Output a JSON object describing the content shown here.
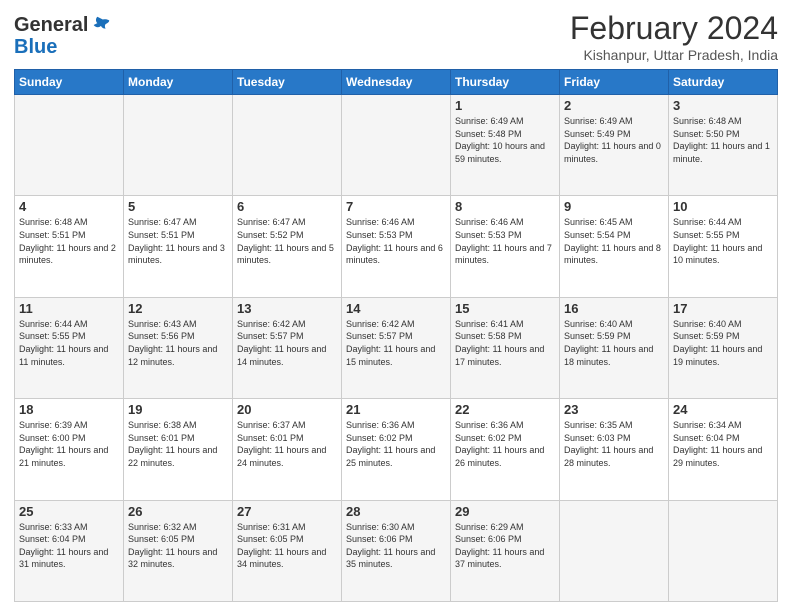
{
  "header": {
    "logo_general": "General",
    "logo_blue": "Blue",
    "month_title": "February 2024",
    "location": "Kishanpur, Uttar Pradesh, India"
  },
  "days_of_week": [
    "Sunday",
    "Monday",
    "Tuesday",
    "Wednesday",
    "Thursday",
    "Friday",
    "Saturday"
  ],
  "weeks": [
    [
      {
        "day": "",
        "info": ""
      },
      {
        "day": "",
        "info": ""
      },
      {
        "day": "",
        "info": ""
      },
      {
        "day": "",
        "info": ""
      },
      {
        "day": "1",
        "info": "Sunrise: 6:49 AM\nSunset: 5:48 PM\nDaylight: 10 hours and 59 minutes."
      },
      {
        "day": "2",
        "info": "Sunrise: 6:49 AM\nSunset: 5:49 PM\nDaylight: 11 hours and 0 minutes."
      },
      {
        "day": "3",
        "info": "Sunrise: 6:48 AM\nSunset: 5:50 PM\nDaylight: 11 hours and 1 minute."
      }
    ],
    [
      {
        "day": "4",
        "info": "Sunrise: 6:48 AM\nSunset: 5:51 PM\nDaylight: 11 hours and 2 minutes."
      },
      {
        "day": "5",
        "info": "Sunrise: 6:47 AM\nSunset: 5:51 PM\nDaylight: 11 hours and 3 minutes."
      },
      {
        "day": "6",
        "info": "Sunrise: 6:47 AM\nSunset: 5:52 PM\nDaylight: 11 hours and 5 minutes."
      },
      {
        "day": "7",
        "info": "Sunrise: 6:46 AM\nSunset: 5:53 PM\nDaylight: 11 hours and 6 minutes."
      },
      {
        "day": "8",
        "info": "Sunrise: 6:46 AM\nSunset: 5:53 PM\nDaylight: 11 hours and 7 minutes."
      },
      {
        "day": "9",
        "info": "Sunrise: 6:45 AM\nSunset: 5:54 PM\nDaylight: 11 hours and 8 minutes."
      },
      {
        "day": "10",
        "info": "Sunrise: 6:44 AM\nSunset: 5:55 PM\nDaylight: 11 hours and 10 minutes."
      }
    ],
    [
      {
        "day": "11",
        "info": "Sunrise: 6:44 AM\nSunset: 5:55 PM\nDaylight: 11 hours and 11 minutes."
      },
      {
        "day": "12",
        "info": "Sunrise: 6:43 AM\nSunset: 5:56 PM\nDaylight: 11 hours and 12 minutes."
      },
      {
        "day": "13",
        "info": "Sunrise: 6:42 AM\nSunset: 5:57 PM\nDaylight: 11 hours and 14 minutes."
      },
      {
        "day": "14",
        "info": "Sunrise: 6:42 AM\nSunset: 5:57 PM\nDaylight: 11 hours and 15 minutes."
      },
      {
        "day": "15",
        "info": "Sunrise: 6:41 AM\nSunset: 5:58 PM\nDaylight: 11 hours and 17 minutes."
      },
      {
        "day": "16",
        "info": "Sunrise: 6:40 AM\nSunset: 5:59 PM\nDaylight: 11 hours and 18 minutes."
      },
      {
        "day": "17",
        "info": "Sunrise: 6:40 AM\nSunset: 5:59 PM\nDaylight: 11 hours and 19 minutes."
      }
    ],
    [
      {
        "day": "18",
        "info": "Sunrise: 6:39 AM\nSunset: 6:00 PM\nDaylight: 11 hours and 21 minutes."
      },
      {
        "day": "19",
        "info": "Sunrise: 6:38 AM\nSunset: 6:01 PM\nDaylight: 11 hours and 22 minutes."
      },
      {
        "day": "20",
        "info": "Sunrise: 6:37 AM\nSunset: 6:01 PM\nDaylight: 11 hours and 24 minutes."
      },
      {
        "day": "21",
        "info": "Sunrise: 6:36 AM\nSunset: 6:02 PM\nDaylight: 11 hours and 25 minutes."
      },
      {
        "day": "22",
        "info": "Sunrise: 6:36 AM\nSunset: 6:02 PM\nDaylight: 11 hours and 26 minutes."
      },
      {
        "day": "23",
        "info": "Sunrise: 6:35 AM\nSunset: 6:03 PM\nDaylight: 11 hours and 28 minutes."
      },
      {
        "day": "24",
        "info": "Sunrise: 6:34 AM\nSunset: 6:04 PM\nDaylight: 11 hours and 29 minutes."
      }
    ],
    [
      {
        "day": "25",
        "info": "Sunrise: 6:33 AM\nSunset: 6:04 PM\nDaylight: 11 hours and 31 minutes."
      },
      {
        "day": "26",
        "info": "Sunrise: 6:32 AM\nSunset: 6:05 PM\nDaylight: 11 hours and 32 minutes."
      },
      {
        "day": "27",
        "info": "Sunrise: 6:31 AM\nSunset: 6:05 PM\nDaylight: 11 hours and 34 minutes."
      },
      {
        "day": "28",
        "info": "Sunrise: 6:30 AM\nSunset: 6:06 PM\nDaylight: 11 hours and 35 minutes."
      },
      {
        "day": "29",
        "info": "Sunrise: 6:29 AM\nSunset: 6:06 PM\nDaylight: 11 hours and 37 minutes."
      },
      {
        "day": "",
        "info": ""
      },
      {
        "day": "",
        "info": ""
      }
    ]
  ]
}
